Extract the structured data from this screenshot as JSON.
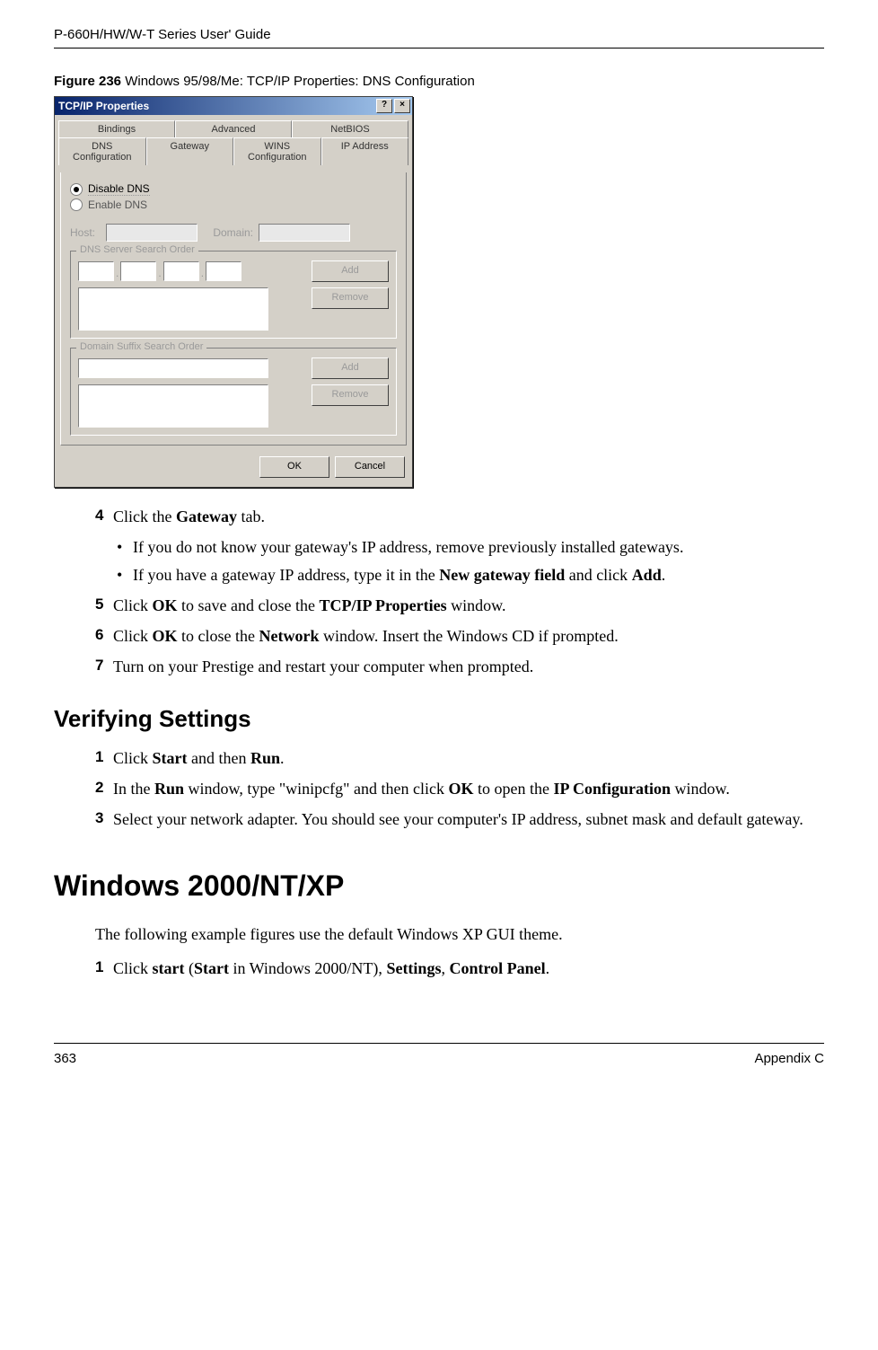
{
  "header": {
    "guide_title": "P-660H/HW/W-T Series User' Guide"
  },
  "figure": {
    "label_bold": "Figure 236",
    "label_rest": "   Windows 95/98/Me: TCP/IP Properties: DNS Configuration"
  },
  "dialog": {
    "title": "TCP/IP Properties",
    "help_btn": "?",
    "close_btn": "×",
    "tabs_top": [
      "Bindings",
      "Advanced",
      "NetBIOS"
    ],
    "tabs_bottom": [
      "DNS Configuration",
      "Gateway",
      "WINS Configuration",
      "IP Address"
    ],
    "radio_disable": "Disable DNS",
    "radio_enable": "Enable DNS",
    "host_label": "Host:",
    "domain_label": "Domain:",
    "group1_title": "DNS Server Search Order",
    "group2_title": "Domain Suffix Search Order",
    "add_btn": "Add",
    "remove_btn": "Remove",
    "ok_btn": "OK",
    "cancel_btn": "Cancel"
  },
  "steps_a": {
    "s4": {
      "num": "4",
      "text_pre": "Click the ",
      "bold1": "Gateway",
      "text_post": " tab."
    },
    "bullets": {
      "b1": "If you do not know your gateway's IP address, remove previously installed gateways.",
      "b2_pre": "If you have a gateway IP address, type it in the ",
      "b2_bold1": "New gateway field",
      "b2_mid": " and click ",
      "b2_bold2": "Add",
      "b2_post": "."
    },
    "s5": {
      "num": "5",
      "pre": "Click ",
      "b1": "OK",
      "mid": " to save and close the ",
      "b2": "TCP/IP Properties",
      "post": " window."
    },
    "s6": {
      "num": "6",
      "pre": "Click ",
      "b1": "OK",
      "mid": " to close the ",
      "b2": "Network",
      "post": " window. Insert the Windows CD if prompted."
    },
    "s7": {
      "num": "7",
      "text": "Turn on your Prestige and restart your computer when prompted."
    }
  },
  "section_verify": {
    "title": "Verifying Settings",
    "s1": {
      "num": "1",
      "pre": "Click ",
      "b1": "Start",
      "mid": " and then ",
      "b2": "Run",
      "post": "."
    },
    "s2": {
      "num": "2",
      "pre": "In the ",
      "b1": "Run",
      "mid1": " window, type \"winipcfg\" and then click ",
      "b2": "OK",
      "mid2": " to open the ",
      "b3": "IP Configuration",
      "post": " window."
    },
    "s3": {
      "num": "3",
      "text": "Select your network adapter. You should see your computer's IP address, subnet mask and default gateway."
    }
  },
  "section_winxp": {
    "title": "Windows 2000/NT/XP",
    "intro": "The following example figures use the default Windows XP GUI theme.",
    "s1": {
      "num": "1",
      "pre": "Click ",
      "b1": "start",
      "mid1": " (",
      "b2": "Start",
      "mid2": " in Windows 2000/NT), ",
      "b3": "Settings",
      "mid3": ", ",
      "b4": "Control Panel",
      "post": "."
    }
  },
  "footer": {
    "page_num": "363",
    "appendix": "Appendix C"
  }
}
